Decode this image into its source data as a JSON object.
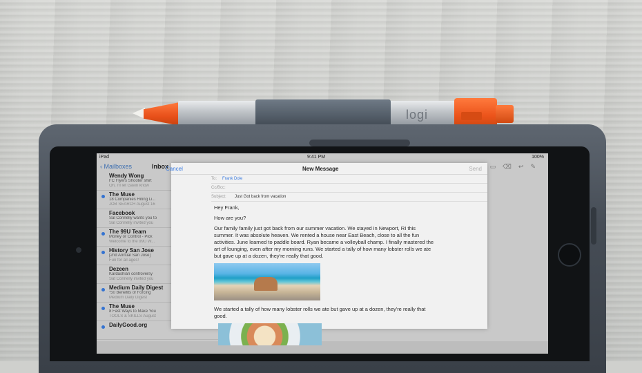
{
  "pencil": {
    "logo": "logi"
  },
  "status": {
    "device": "iPad",
    "time": "9:41 PM",
    "battery": "100%"
  },
  "mail": {
    "back_label": "Mailboxes",
    "inbox_label": "Inbox",
    "items": [
      {
        "sender": "Wendy Wong",
        "subject": "FC Flyers Shooter shirt",
        "preview": "Oh, I'll let Gavin know",
        "unread": false
      },
      {
        "sender": "The Muse",
        "subject": "18 Companies Hiring Li...",
        "preview": "JOB SEARCH August 16",
        "unread": true
      },
      {
        "sender": "Facebook",
        "subject": "Sal Connelly wants you to",
        "preview": "Sal Connelly invited you",
        "unread": false
      },
      {
        "sender": "The 99U Team",
        "subject": "Money or Control - Pick",
        "preview": "Welcome to the 99U W...",
        "unread": true
      },
      {
        "sender": "History San Jose",
        "subject": "[2nd Annual San Jose]",
        "preview": "Fun for all ages!",
        "unread": true
      },
      {
        "sender": "Dezeen",
        "subject": "Kardashian controversy",
        "preview": "Sat Connelly invited you",
        "unread": false
      },
      {
        "sender": "Medium Daily Digest",
        "subject": "\"50 Benefits of Forcing",
        "preview": "Medium Daily Digest",
        "unread": true
      },
      {
        "sender": "The Muse",
        "subject": "8 Fast Ways to Make You",
        "preview": "TOOLS & SKILLS August",
        "unread": true
      },
      {
        "sender": "DailyGood.org",
        "subject": "",
        "preview": "",
        "unread": true
      }
    ]
  },
  "compose": {
    "cancel": "Cancel",
    "title": "New Message",
    "send": "Send",
    "to_label": "To:",
    "to_value": "Frank Dole",
    "cc_label": "Cc/Bcc:",
    "subject_label": "Subject:",
    "subject_value": "Just Got back from vacation",
    "greeting": "Hey Frank,",
    "line2": "How are you?",
    "para1": "Our family family just got back from our summer vacation. We stayed in Newport, RI this summer. It was absolute heaven. We rented a house near East Beach, close to all the fun activities. June learned to paddle board. Ryan became a volleyball champ. I finally mastered the art of lounging, even after my morning runs. We started a tally of how many lobster rolls we ate but gave up at a dozen, they're really that good.",
    "para2": "We started a tally of how many lobster rolls we ate but gave up at a dozen, they're really that good."
  }
}
